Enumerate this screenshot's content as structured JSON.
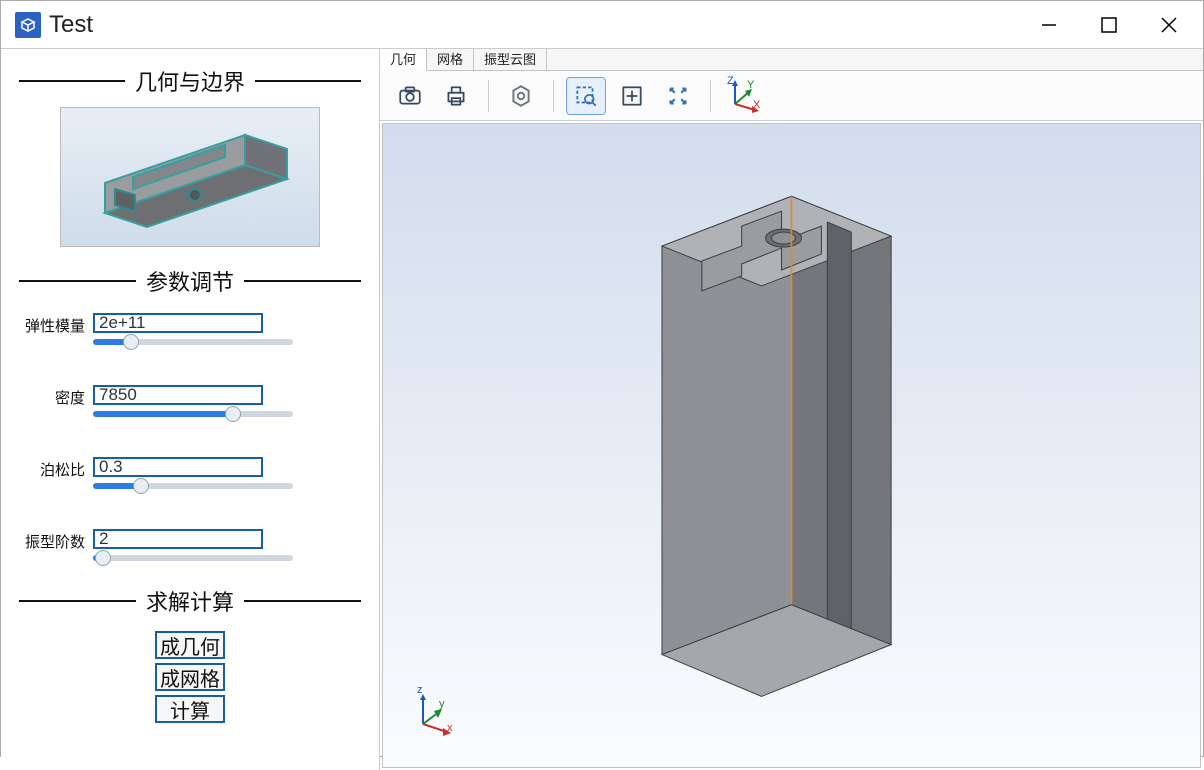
{
  "window": {
    "title": "Test"
  },
  "sidebar": {
    "section_geometry": "几何与边界",
    "section_params": "参数调节",
    "section_solve": "求解计算",
    "params": {
      "elastic_label": "弹性模量",
      "elastic_value": "2e+11",
      "density_label": "密度",
      "density_value": "7850",
      "poisson_label": "泊松比",
      "poisson_value": "0.3",
      "modes_label": "振型阶数",
      "modes_value": "2"
    },
    "solve": {
      "btn_geometry": "成几何",
      "btn_mesh": "成网格",
      "btn_compute": "计算"
    }
  },
  "main": {
    "tabs": {
      "geometry": "几何",
      "mesh": "网格",
      "mode_cloud": "振型云图"
    },
    "axes": {
      "x": "X",
      "y": "Y",
      "z": "Z",
      "xl": "x",
      "yl": "y",
      "zl": "z"
    }
  }
}
